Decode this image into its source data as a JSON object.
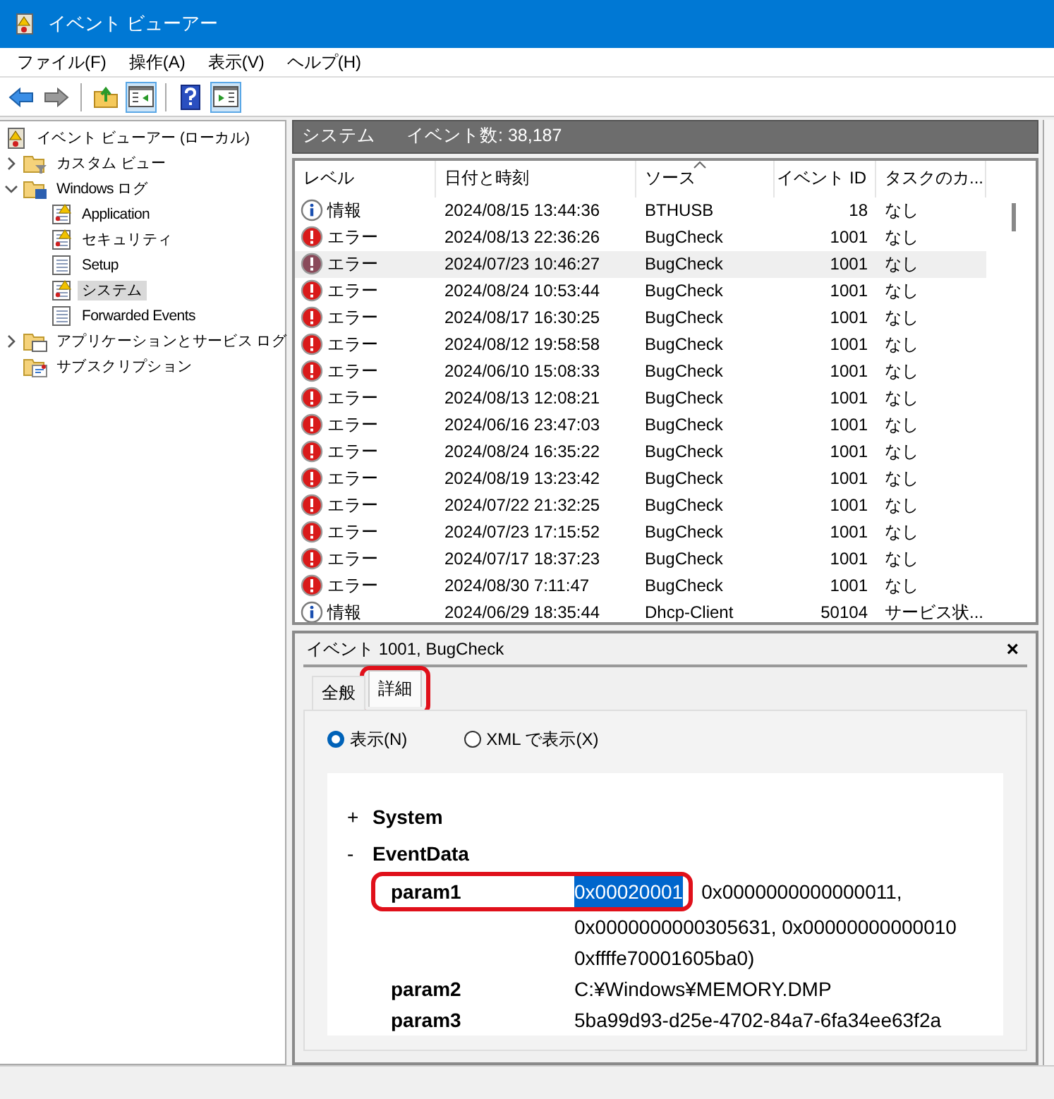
{
  "window": {
    "title": "イベント ビューアー"
  },
  "menu": [
    "ファイル(F)",
    "操作(A)",
    "表示(V)",
    "ヘルプ(H)"
  ],
  "toolbar": [
    {
      "kind": "back",
      "pressed": false
    },
    {
      "kind": "forward",
      "pressed": false
    },
    {
      "kind": "separator"
    },
    {
      "kind": "up",
      "pressed": false
    },
    {
      "kind": "tree",
      "pressed": true
    },
    {
      "kind": "separator"
    },
    {
      "kind": "help",
      "pressed": false
    },
    {
      "kind": "actions",
      "pressed": true
    }
  ],
  "tree": [
    {
      "label": "イベント ビューアー (ローカル)",
      "kind": "root",
      "selected": false,
      "children": [
        {
          "label": "カスタム ビュー",
          "kind": "filter-folder",
          "selected": false,
          "expanded": false
        },
        {
          "label": "Windows ログ",
          "kind": "windows-folder",
          "selected": false,
          "expanded": true,
          "children": [
            {
              "label": "Application",
              "kind": "warn-log",
              "selected": false
            },
            {
              "label": "セキュリティ",
              "kind": "warn-log",
              "selected": false
            },
            {
              "label": "Setup",
              "kind": "log",
              "selected": false
            },
            {
              "label": "システム",
              "kind": "warn-log",
              "selected": true
            },
            {
              "label": "Forwarded Events",
              "kind": "log",
              "selected": false
            }
          ]
        },
        {
          "label": "アプリケーションとサービス ログ",
          "kind": "app-folder",
          "selected": false,
          "expanded": false
        },
        {
          "label": "サブスクリプション",
          "kind": "sub-folder",
          "selected": false
        }
      ]
    }
  ],
  "log_header": {
    "name": "システム",
    "count": "イベント数: 38,187"
  },
  "table": {
    "columns": [
      {
        "label": "レベル",
        "sorted": false
      },
      {
        "label": "日付と時刻",
        "sorted": false
      },
      {
        "label": "ソース",
        "sorted": true
      },
      {
        "label": "イベント ID",
        "sorted": false
      },
      {
        "label": "タスクのカ...",
        "sorted": false
      }
    ],
    "rows": [
      {
        "kind": "info",
        "level": "情報",
        "date": "2024/08/15 13:44:36",
        "source": "BTHUSB",
        "id": "18",
        "task": "なし",
        "selected": false
      },
      {
        "kind": "error",
        "level": "エラー",
        "date": "2024/08/13 22:36:26",
        "source": "BugCheck",
        "id": "1001",
        "task": "なし",
        "selected": false
      },
      {
        "kind": "error",
        "level": "エラー",
        "date": "2024/07/23 10:46:27",
        "source": "BugCheck",
        "id": "1001",
        "task": "なし",
        "selected": true
      },
      {
        "kind": "error",
        "level": "エラー",
        "date": "2024/08/24 10:53:44",
        "source": "BugCheck",
        "id": "1001",
        "task": "なし",
        "selected": false
      },
      {
        "kind": "error",
        "level": "エラー",
        "date": "2024/08/17 16:30:25",
        "source": "BugCheck",
        "id": "1001",
        "task": "なし",
        "selected": false
      },
      {
        "kind": "error",
        "level": "エラー",
        "date": "2024/08/12 19:58:58",
        "source": "BugCheck",
        "id": "1001",
        "task": "なし",
        "selected": false
      },
      {
        "kind": "error",
        "level": "エラー",
        "date": "2024/06/10 15:08:33",
        "source": "BugCheck",
        "id": "1001",
        "task": "なし",
        "selected": false
      },
      {
        "kind": "error",
        "level": "エラー",
        "date": "2024/08/13 12:08:21",
        "source": "BugCheck",
        "id": "1001",
        "task": "なし",
        "selected": false
      },
      {
        "kind": "error",
        "level": "エラー",
        "date": "2024/06/16 23:47:03",
        "source": "BugCheck",
        "id": "1001",
        "task": "なし",
        "selected": false
      },
      {
        "kind": "error",
        "level": "エラー",
        "date": "2024/08/24 16:35:22",
        "source": "BugCheck",
        "id": "1001",
        "task": "なし",
        "selected": false
      },
      {
        "kind": "error",
        "level": "エラー",
        "date": "2024/08/19 13:23:42",
        "source": "BugCheck",
        "id": "1001",
        "task": "なし",
        "selected": false
      },
      {
        "kind": "error",
        "level": "エラー",
        "date": "2024/07/22 21:32:25",
        "source": "BugCheck",
        "id": "1001",
        "task": "なし",
        "selected": false
      },
      {
        "kind": "error",
        "level": "エラー",
        "date": "2024/07/23 17:15:52",
        "source": "BugCheck",
        "id": "1001",
        "task": "なし",
        "selected": false
      },
      {
        "kind": "error",
        "level": "エラー",
        "date": "2024/07/17 18:37:23",
        "source": "BugCheck",
        "id": "1001",
        "task": "なし",
        "selected": false
      },
      {
        "kind": "error",
        "level": "エラー",
        "date": "2024/08/30 7:11:47",
        "source": "BugCheck",
        "id": "1001",
        "task": "なし",
        "selected": false
      },
      {
        "kind": "info",
        "level": "情報",
        "date": "2024/06/29 18:35:44",
        "source": "Dhcp-Client",
        "id": "50104",
        "task": "サービス状...",
        "selected": false
      }
    ]
  },
  "detail": {
    "title": "イベント 1001, BugCheck",
    "close": "×",
    "tabs": [
      {
        "label": "全般",
        "selected": false,
        "outlined": false
      },
      {
        "label": "詳細",
        "selected": true,
        "outlined": true
      }
    ],
    "views": [
      {
        "label": "表示(N)",
        "selected": true
      },
      {
        "label": "XML で表示(X)",
        "selected": false
      }
    ],
    "sections": [
      {
        "toggle": "+",
        "name": "System"
      },
      {
        "toggle": "-",
        "name": "EventData",
        "params": [
          {
            "name": "param1",
            "highlighted": "0x00020001",
            "lines": [
              "0x0000000000000011,",
              "0x0000000000305631, 0x00000000000010",
              "0xffffe70001605ba0)"
            ],
            "outlined": true
          },
          {
            "name": "param2",
            "lines": [
              "C:¥Windows¥MEMORY.DMP"
            ]
          },
          {
            "name": "param3",
            "lines": [
              "5ba99d93-d25e-4702-84a7-6fa34ee63f2a"
            ]
          }
        ]
      }
    ]
  }
}
